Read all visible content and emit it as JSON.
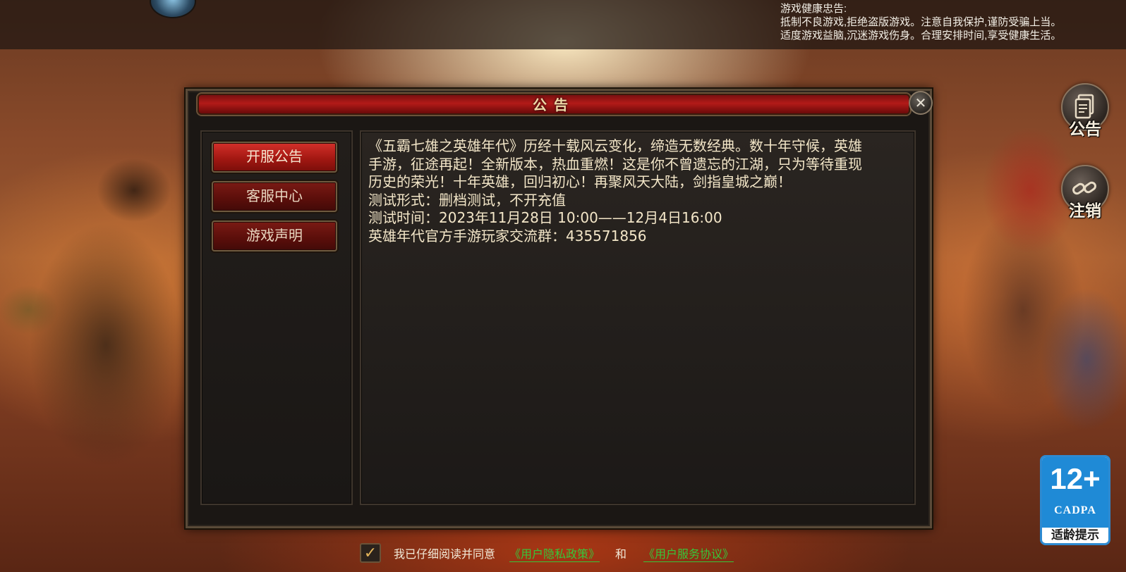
{
  "top_bar": {
    "health_lines": [
      "游戏健康忠告:",
      "抵制不良游戏,拒绝盗版游戏。注意自我保护,谨防受骗上当。",
      "适度游戏益脑,沉迷游戏伤身。合理安排时间,享受健康生活。"
    ]
  },
  "side_buttons": {
    "notice_label": "公告",
    "notice_icon": "document-icon",
    "logout_label": "注销",
    "logout_icon": "link-icon"
  },
  "dialog": {
    "title": "公告",
    "close_symbol": "✕",
    "menu": [
      {
        "label": "开服公告",
        "active": true
      },
      {
        "label": "客服中心",
        "active": false
      },
      {
        "label": "游戏声明",
        "active": false
      }
    ],
    "content_lines": [
      "《五霸七雄之英雄年代》历经十载风云变化，缔造无数经典。数十年守候，英雄",
      "手游，征途再起！全新版本，热血重燃！这是你不曾遗忘的江湖，只为等待重现",
      "历史的荣光！十年英雄，回归初心！再聚风天大陆，剑指皇城之巅！",
      "测试形式：删档测试，不开充值",
      "测试时间：2023年11月28日 10:00——12月4日16:00",
      "英雄年代官方手游玩家交流群：435571856"
    ]
  },
  "agreement": {
    "checked": true,
    "check_symbol": "✓",
    "text": "我已仔细阅读并同意",
    "privacy_link": "《用户隐私政策》",
    "and": "和",
    "service_link": "《用户服务协议》"
  },
  "age_badge": {
    "age": "12+",
    "org": "CADPA",
    "caption": "适龄提示"
  },
  "colors": {
    "accent_red": "#b21a18",
    "content_text": "#f3e6c8",
    "link_green": "#37c63a",
    "badge_blue": "#1f8ad6"
  }
}
